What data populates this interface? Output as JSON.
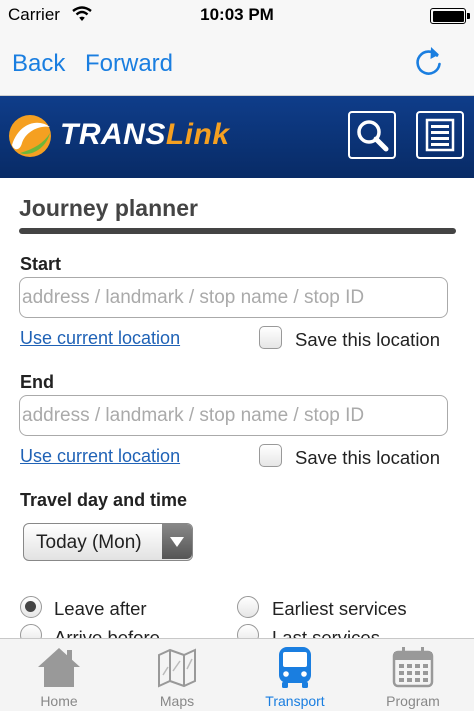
{
  "status_bar": {
    "carrier": "Carrier",
    "time": "10:03 PM",
    "battery_level": 1.0
  },
  "browser_nav": {
    "back": "Back",
    "forward": "Forward"
  },
  "header": {
    "brand_left": "TRANS",
    "brand_right": "Link"
  },
  "journey": {
    "title": "Journey planner",
    "start": {
      "label": "Start",
      "placeholder": "address / landmark / stop name / stop ID",
      "value": "",
      "use_location": "Use current location",
      "save_location": "Save this location",
      "save_checked": false
    },
    "end": {
      "label": "End",
      "placeholder": "address / landmark / stop name / stop ID",
      "value": "",
      "use_location": "Use current location",
      "save_location": "Save this location",
      "save_checked": false
    },
    "travel": {
      "label": "Travel day and time",
      "day_selected": "Today (Mon)"
    },
    "options": {
      "leave_after": "Leave after",
      "arrive_before": "Arrive before",
      "earliest": "Earliest services",
      "last": "Last services",
      "selected": "leave_after"
    }
  },
  "tabs": [
    {
      "label": "Home",
      "icon": "home-icon"
    },
    {
      "label": "Maps",
      "icon": "map-icon"
    },
    {
      "label": "Transport",
      "icon": "bus-icon"
    },
    {
      "label": "Program",
      "icon": "calendar-icon"
    }
  ],
  "active_tab": "Transport",
  "colors": {
    "brand_navy": "#0f3d8a",
    "brand_orange": "#f5a021",
    "ios_blue": "#1a7ee0",
    "link_blue": "#1f62b6"
  }
}
